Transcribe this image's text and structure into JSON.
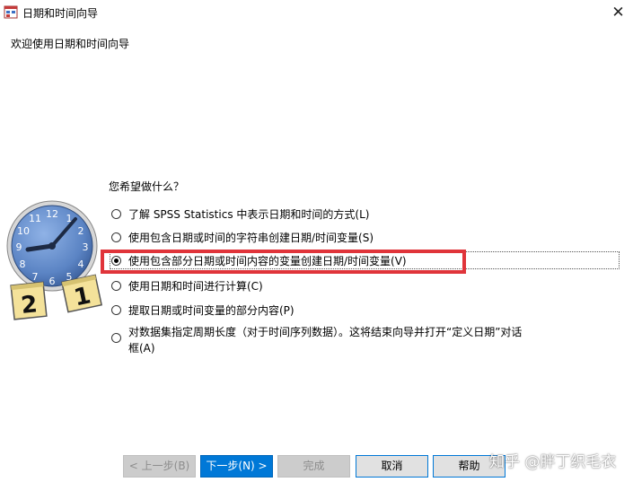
{
  "window": {
    "title": "日期和时间向导",
    "subtitle": "欢迎使用日期和时间向导",
    "close_glyph": "✕"
  },
  "question": "您希望做什么？",
  "options": [
    {
      "label": "了解 SPSS Statistics 中表示日期和时间的方式(L)",
      "selected": false
    },
    {
      "label": "使用包含日期或时间的字符串创建日期/时间变量(S)",
      "selected": false
    },
    {
      "label": "使用包含部分日期或时间内容的变量创建日期/时间变量(V)",
      "selected": true
    },
    {
      "label": "使用日期和时间进行计算(C)",
      "selected": false
    },
    {
      "label": "提取日期或时间变量的部分内容(P)",
      "selected": false
    },
    {
      "label": "对数据集指定周期长度（对于时间序列数据）。这将结束向导并打开“定义日期”对话框(A)",
      "selected": false
    }
  ],
  "buttons": {
    "back": "< 上一步(B)",
    "next": "下一步(N) >",
    "finish": "完成",
    "cancel": "取消",
    "help": "帮助"
  },
  "clock_art": {
    "numbers": [
      "12",
      "1",
      "2",
      "3",
      "4",
      "5",
      "6",
      "7",
      "8",
      "9",
      "10",
      "11"
    ],
    "card_left": "2",
    "card_right": "1"
  },
  "watermark": "知乎 @胖丁织毛衣",
  "colors": {
    "highlight_border": "#e0343a",
    "primary_button": "#0078d7",
    "clock_face": "#5b84c4"
  }
}
